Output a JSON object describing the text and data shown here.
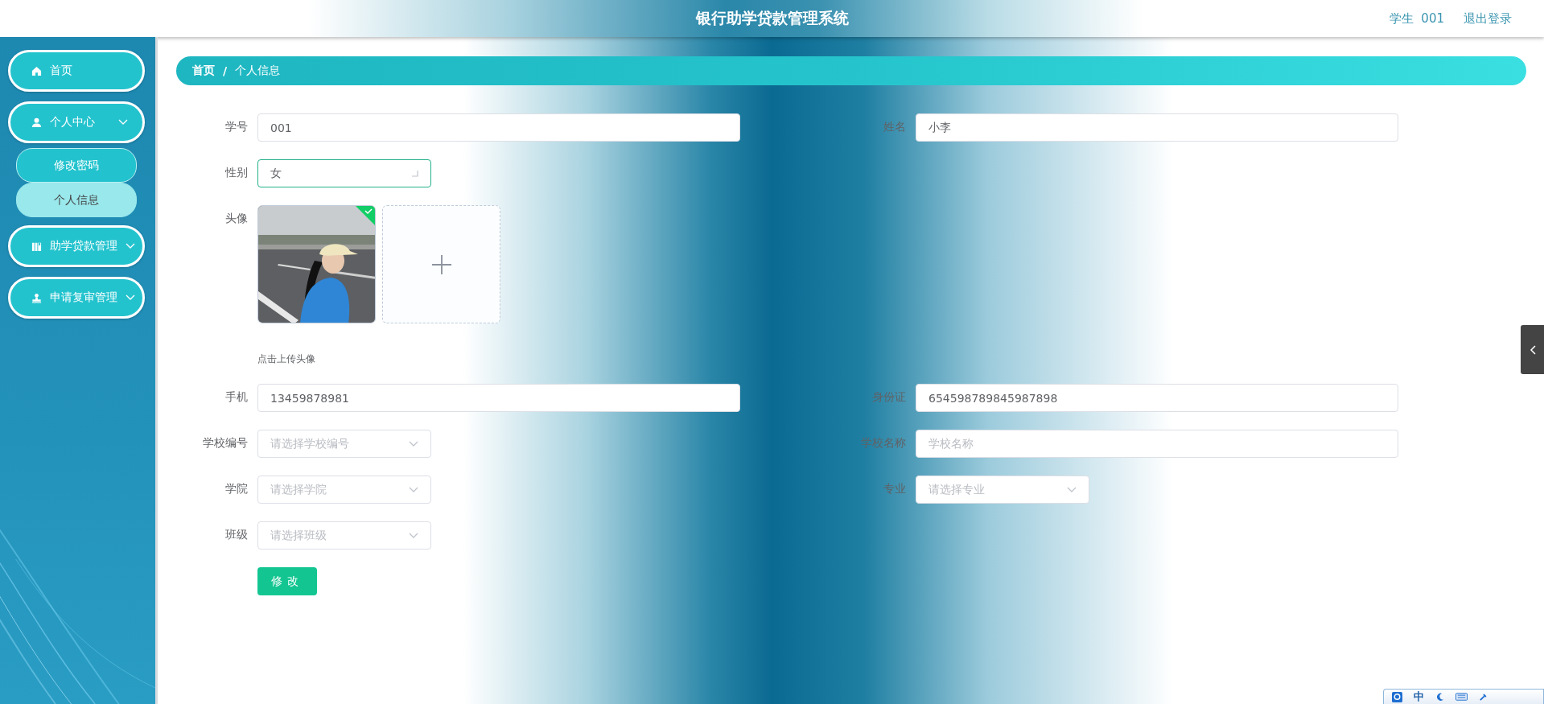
{
  "header": {
    "title": "银行助学贷款管理系统",
    "user_role": "学生",
    "user_name": "001",
    "logout": "退出登录"
  },
  "sidebar": {
    "items": [
      {
        "label": "首页",
        "kind": "link"
      },
      {
        "label": "个人中心",
        "kind": "submenu",
        "children": [
          {
            "label": "修改密码",
            "selected": false
          },
          {
            "label": "个人信息",
            "selected": true
          }
        ]
      },
      {
        "label": "助学贷款管理",
        "kind": "submenu"
      },
      {
        "label": "申请复审管理",
        "kind": "submenu"
      }
    ]
  },
  "breadcrumb": {
    "items": [
      "首页",
      "个人信息"
    ],
    "separator": "/"
  },
  "form": {
    "rows": [
      {
        "left": {
          "label": "学号",
          "kind": "input",
          "value": "001"
        },
        "right": {
          "label": "姓名",
          "kind": "input",
          "value": "小李"
        }
      },
      {
        "left": {
          "label": "性别",
          "kind": "select",
          "value": "女",
          "focused": true
        }
      },
      {
        "left": {
          "label": "头像",
          "kind": "upload",
          "uploaded": true,
          "hint": "点击上传头像"
        }
      },
      {
        "left": {
          "label": "手机",
          "kind": "input",
          "value": "13459878981"
        },
        "right": {
          "label": "身份证",
          "kind": "input",
          "value": "654598789845987898"
        }
      },
      {
        "left": {
          "label": "学校编号",
          "kind": "select",
          "placeholder": "请选择学校编号",
          "focused": false
        },
        "right": {
          "label": "学校名称",
          "kind": "input",
          "placeholder": "学校名称"
        }
      },
      {
        "left": {
          "label": "学院",
          "kind": "select",
          "placeholder": "请选择学院",
          "focused": false
        },
        "right": {
          "label": "专业",
          "kind": "select",
          "placeholder": "请选择专业",
          "focused": false
        }
      },
      {
        "left": {
          "label": "班级",
          "kind": "select",
          "placeholder": "请选择班级",
          "focused": false
        }
      }
    ],
    "submit": "修改"
  },
  "ime_toolbar": {
    "mode": "中"
  }
}
